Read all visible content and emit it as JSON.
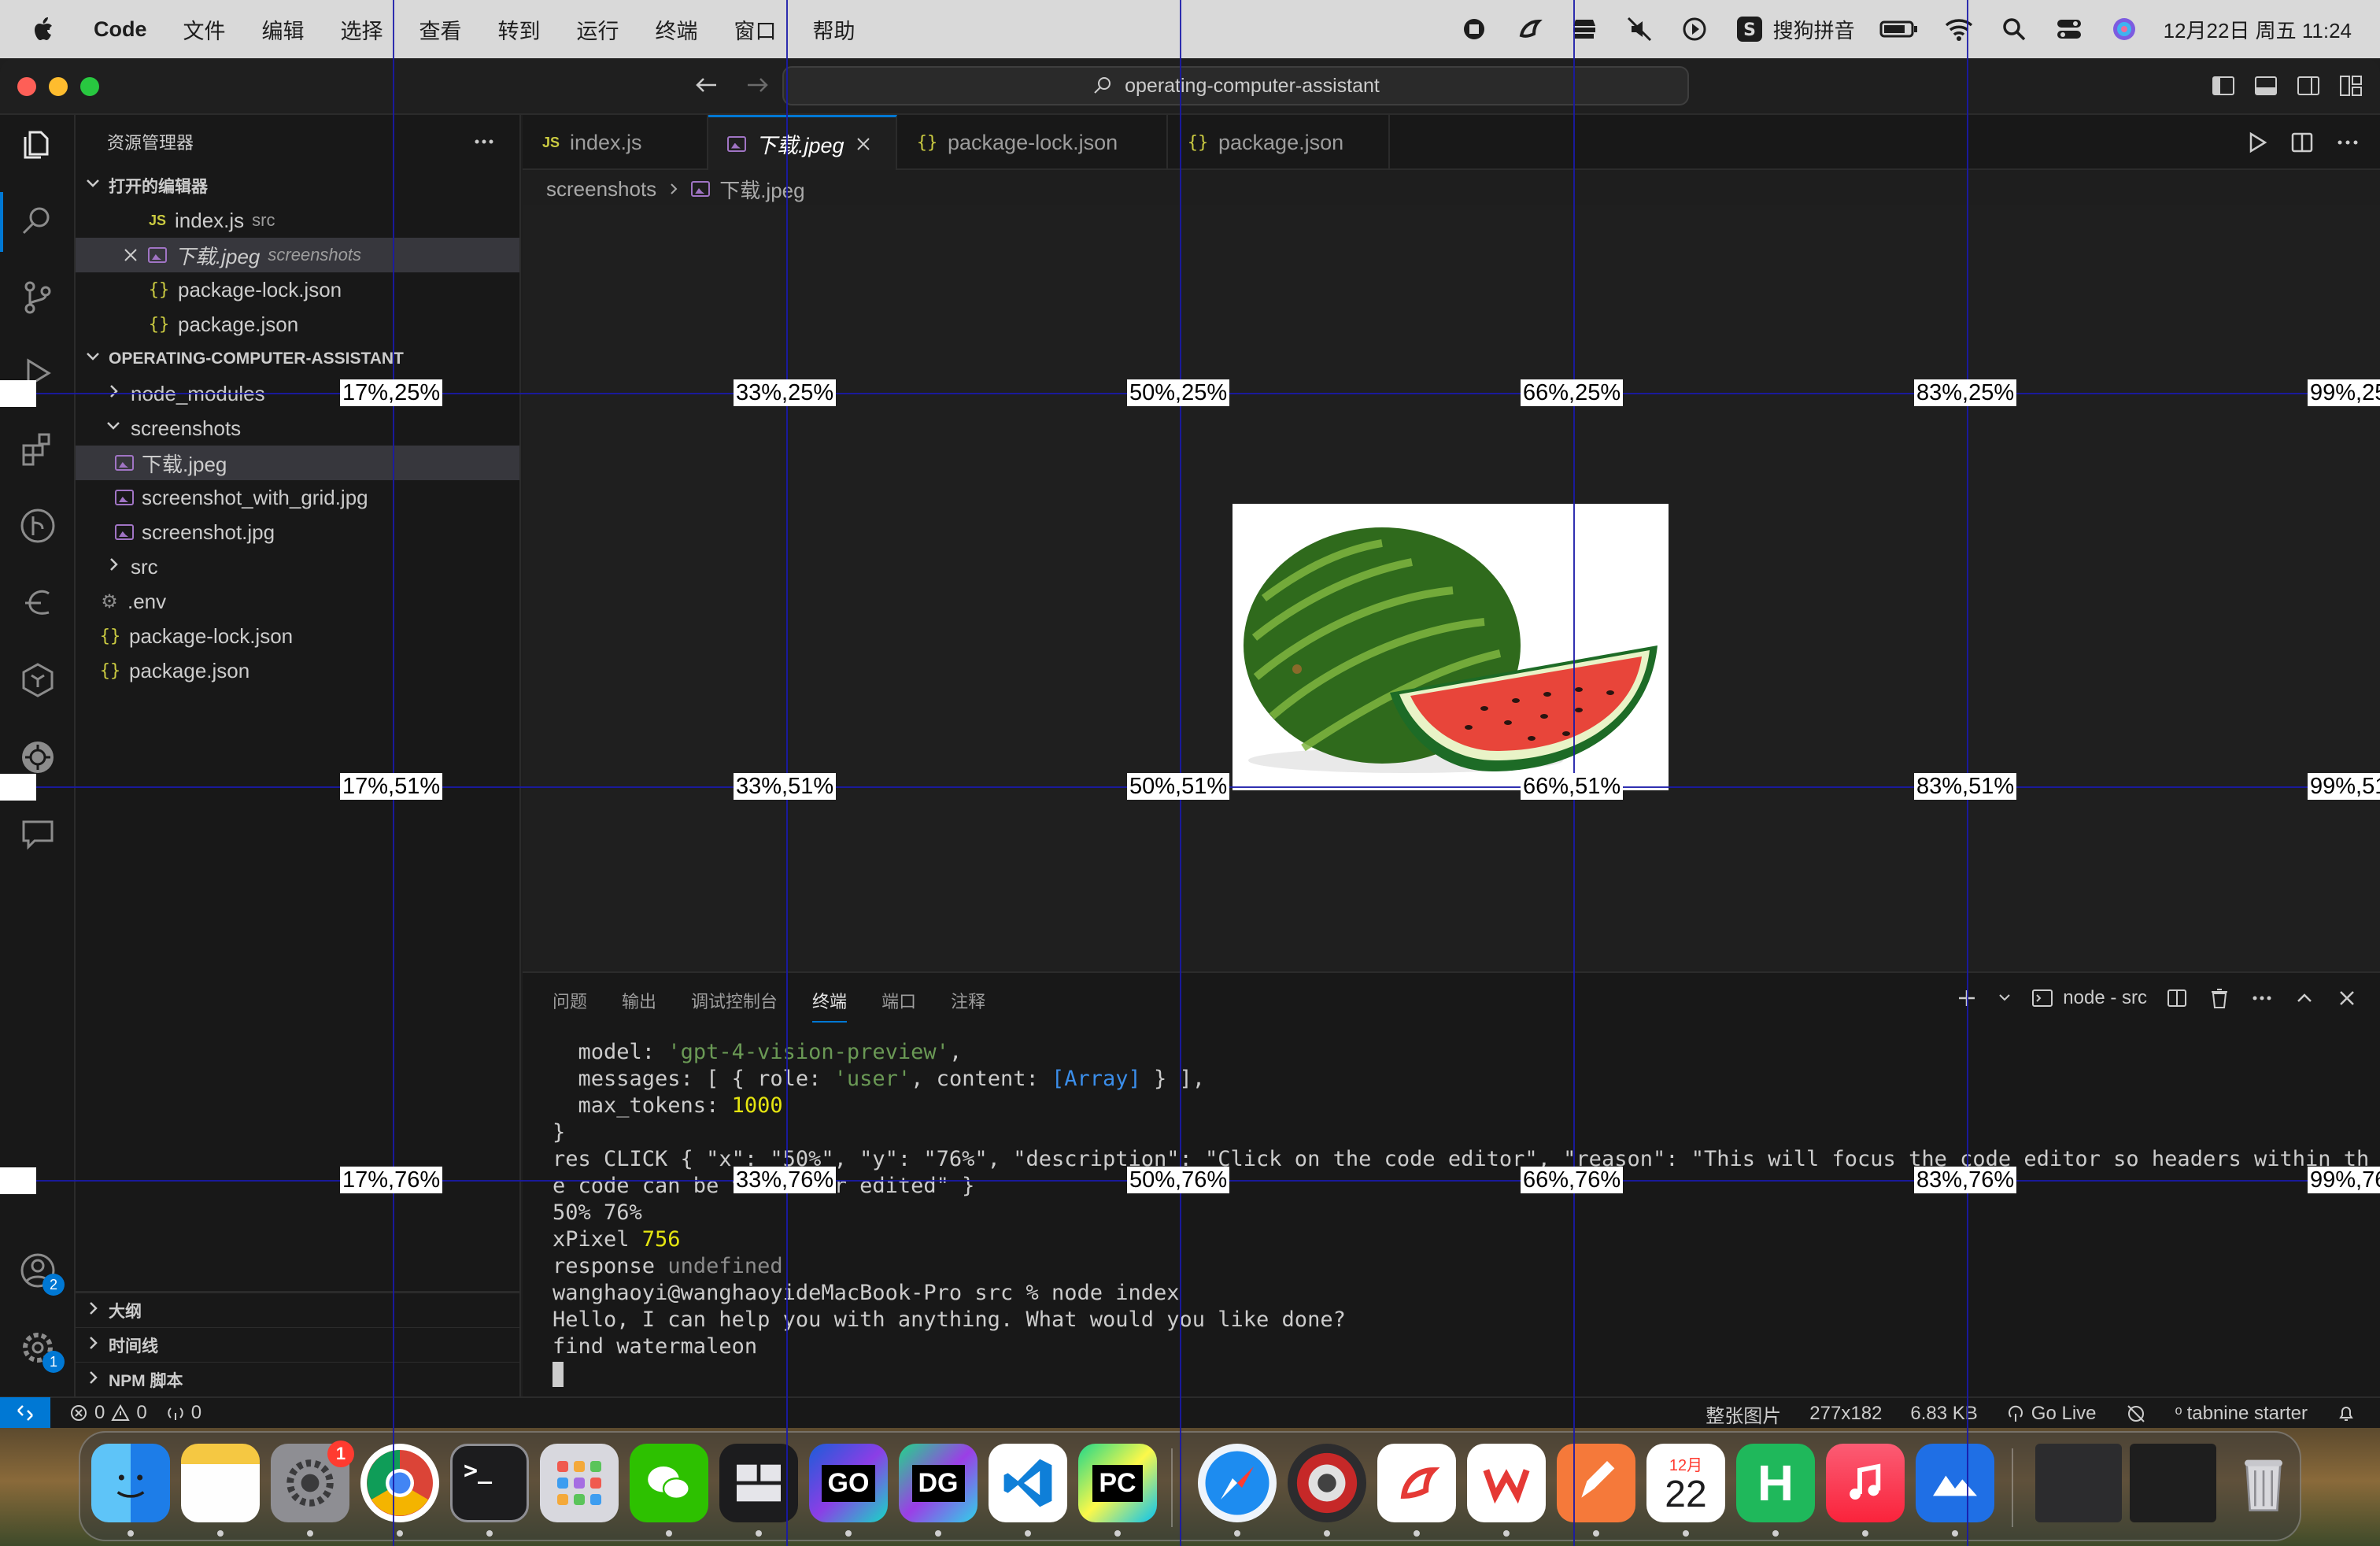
{
  "menubar": {
    "app_name": "Code",
    "menus": [
      "文件",
      "编辑",
      "选择",
      "查看",
      "转到",
      "运行",
      "终端",
      "窗口",
      "帮助"
    ],
    "input_method": "搜狗拼音",
    "datetime": "12月22日 周五  11:24",
    "icons": [
      "record-icon",
      "feishu-icon",
      "tray-icon",
      "mute-icon",
      "play-icon",
      "sogou-icon",
      "battery-icon",
      "wifi-icon",
      "search-icon",
      "control-center-icon",
      "siri-icon"
    ]
  },
  "window": {
    "command_center": "operating-computer-assistant",
    "traffic_colors": {
      "close": "#fe5f57",
      "minimize": "#febc2e",
      "zoom": "#28c840"
    }
  },
  "sidebar": {
    "title": "资源管理器",
    "open_editors_title": "打开的编辑器",
    "open_editors": [
      {
        "name": "index.js",
        "desc": "src",
        "icon": "js"
      },
      {
        "name": "下载.jpeg",
        "desc": "screenshots",
        "icon": "image"
      },
      {
        "name": "package-lock.json",
        "desc": "",
        "icon": "json"
      },
      {
        "name": "package.json",
        "desc": "",
        "icon": "json"
      }
    ],
    "project_title": "OPERATING-COMPUTER-ASSISTANT",
    "tree": [
      {
        "name": "node_modules",
        "kind": "folder-collapsed"
      },
      {
        "name": "screenshots",
        "kind": "folder-open"
      },
      {
        "name": "下载.jpeg",
        "kind": "image"
      },
      {
        "name": "screenshot_with_grid.jpg",
        "kind": "image"
      },
      {
        "name": "screenshot.jpg",
        "kind": "image"
      },
      {
        "name": "src",
        "kind": "folder-collapsed"
      },
      {
        "name": ".env",
        "kind": "gear"
      },
      {
        "name": "package-lock.json",
        "kind": "json"
      },
      {
        "name": "package.json",
        "kind": "json"
      }
    ],
    "bottom_sections": [
      "大纲",
      "时间线",
      "NPM 脚本"
    ]
  },
  "activity_badges": {
    "accounts": "2",
    "manage": "1"
  },
  "tabs": [
    {
      "label": "index.js",
      "icon": "js"
    },
    {
      "label": "下载.jpeg",
      "icon": "image",
      "active": true
    },
    {
      "label": "package-lock.json",
      "icon": "json"
    },
    {
      "label": "package.json",
      "icon": "json"
    }
  ],
  "breadcrumb": {
    "folder": "screenshots",
    "file": "下载.jpeg"
  },
  "panel": {
    "tabs": [
      "问题",
      "输出",
      "调试控制台",
      "终端",
      "端口",
      "注释"
    ],
    "active_tab": "终端",
    "terminal_name": "node - src"
  },
  "terminal": {
    "l1_key": "  model: ",
    "l1_val": "'gpt-4-vision-preview'",
    "l1_end": ",",
    "l2_a": "  messages: [ { role: ",
    "l2_b": "'user'",
    "l2_c": ", content: ",
    "l2_d": "[Array]",
    "l2_e": " } ],",
    "l3_a": "  max_tokens: ",
    "l3_b": "1000",
    "l4": "}",
    "l5": "res CLICK { \"x\": \"50%\", \"y\": \"76%\", \"description\": \"Click on the code editor\", \"reason\": \"This will focus the code editor so headers within th",
    "l6": "e code can be viewed or edited\" }",
    "l7": "50% 76%",
    "l8_a": "xPixel ",
    "l8_b": "756",
    "l9_a": "response ",
    "l9_b": "undefined",
    "l10": "wanghaoyi@wanghaoyideMacBook-Pro src % node index",
    "l11": "Hello, I can help you with anything. What would you like done?",
    "l12": "find watermaleon"
  },
  "statusbar": {
    "errors": "0",
    "warnings": "0",
    "ports": "0",
    "image_mode": "整张图片",
    "dimensions": "277x182",
    "size": "6.83 KB",
    "go_live": "Go Live",
    "tabnine": "tabnine starter"
  },
  "grid_overlay": {
    "col_labels": [
      "17%",
      "33%",
      "50%",
      "66%",
      "83%",
      "99%"
    ],
    "row_labels": [
      "25%",
      "51%",
      "76%"
    ]
  },
  "dock": {
    "apps": [
      "finder-icon",
      "notes-icon",
      "system-settings-icon",
      "chrome-icon",
      "terminal-icon",
      "launchpad-icon",
      "wechat-icon",
      "finder-window-icon",
      "goland-icon",
      "datagrip-icon",
      "vscode-icon",
      "pycharm-icon",
      "safari-icon",
      "screenshot-tool-icon",
      "feishu-icon",
      "wps-icon",
      "pages-icon",
      "calendar-icon",
      "h-app-icon",
      "music-icon",
      "lark-icon",
      "trash-icon"
    ],
    "labels": {
      "goland": "GO",
      "datagrip": "DG",
      "pycharm": "PC",
      "calendar_month": "12月",
      "calendar_day": "22"
    },
    "settings_badge": "1"
  }
}
